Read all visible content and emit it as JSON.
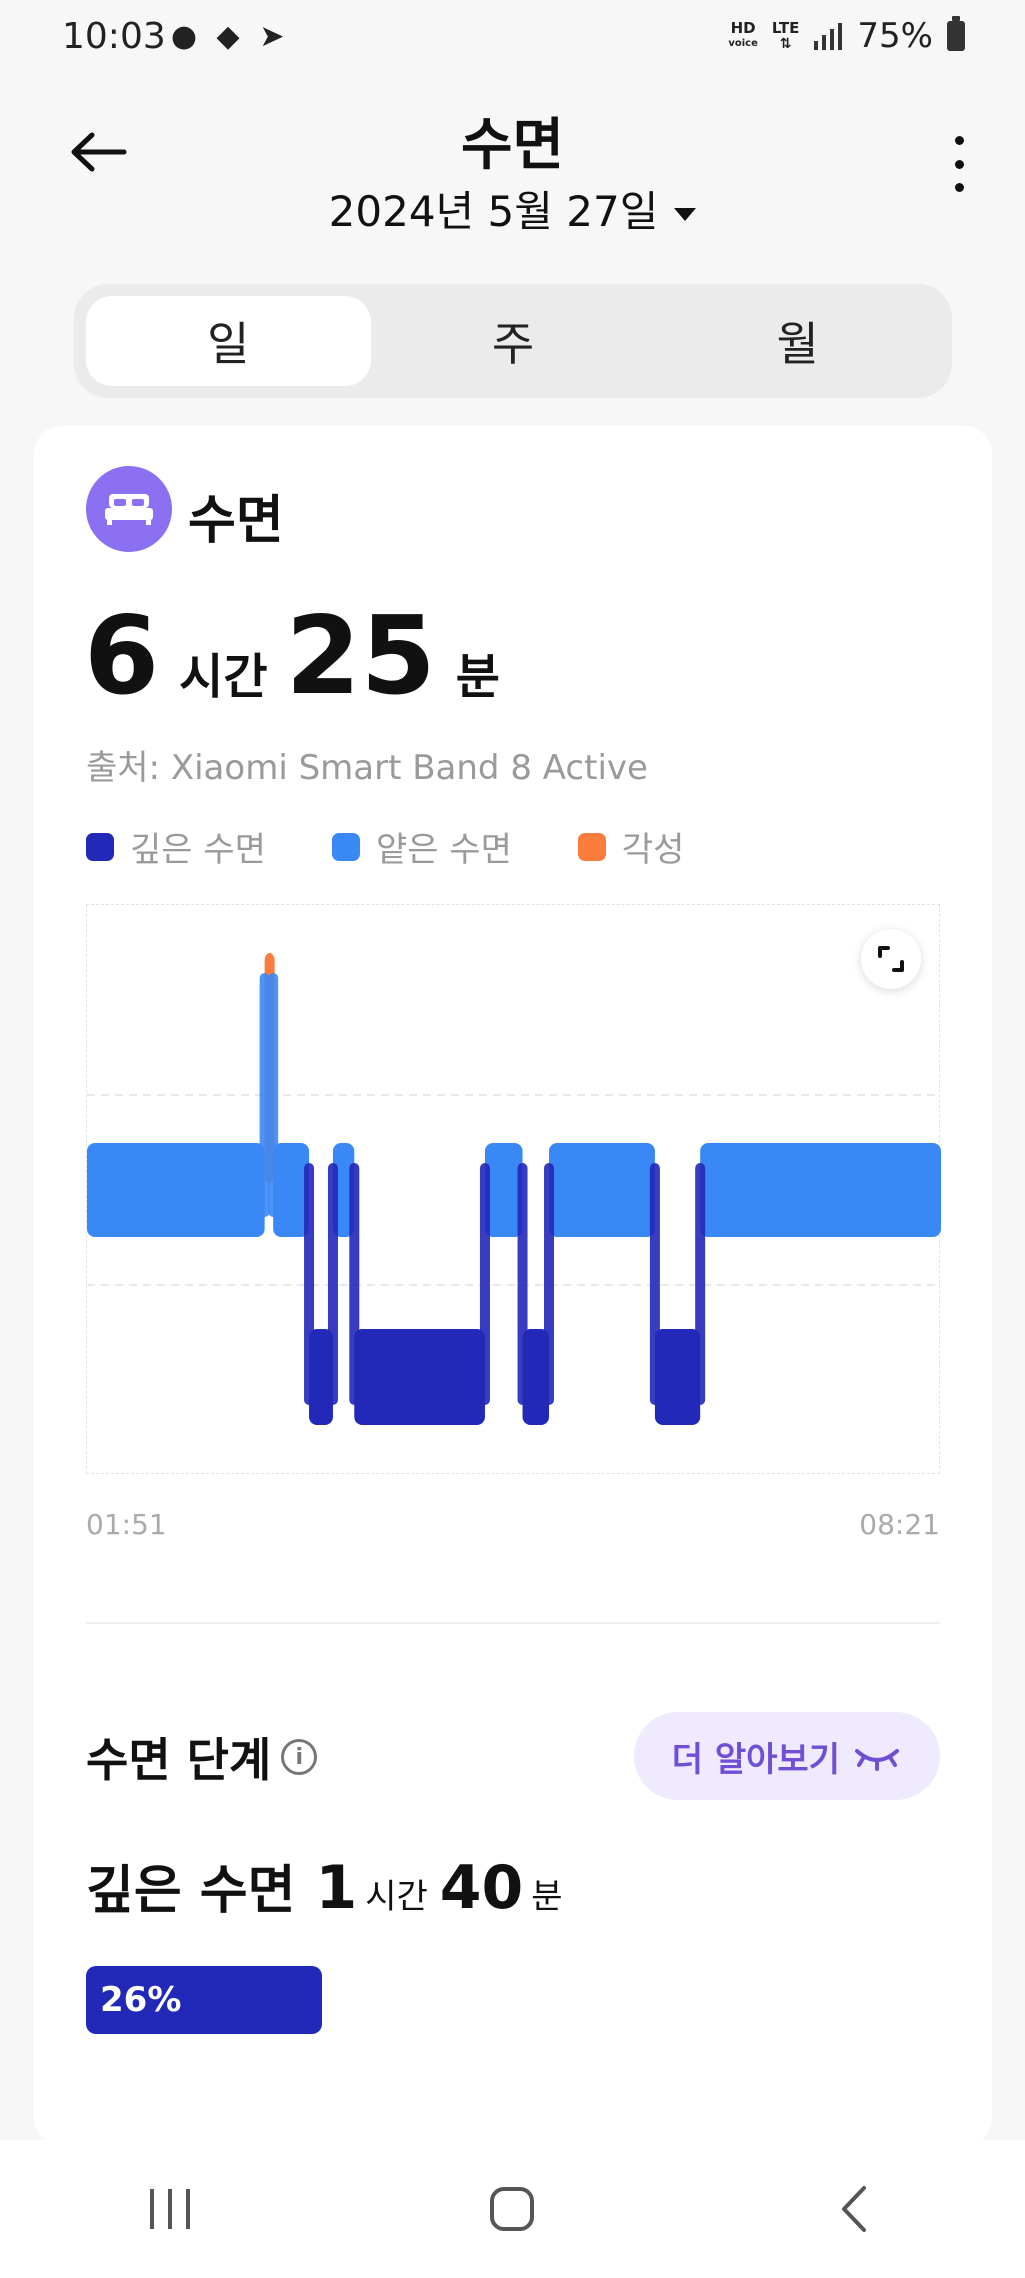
{
  "status_bar": {
    "time": "10:03",
    "hd_label": "HD",
    "voice_label": "voice",
    "lte_label": "LTE",
    "battery": "75%"
  },
  "header": {
    "title": "수면",
    "date": "2024년 5월 27일"
  },
  "tabs": [
    {
      "label": "일",
      "active": true
    },
    {
      "label": "주",
      "active": false
    },
    {
      "label": "월",
      "active": false
    }
  ],
  "card": {
    "title": "수면",
    "duration": {
      "hours": "6",
      "hours_unit": "시간",
      "minutes": "25",
      "minutes_unit": "분"
    },
    "source": "출처: Xiaomi Smart Band 8 Active",
    "legend": [
      {
        "label": "깊은 수면",
        "color": "#2228b8"
      },
      {
        "label": "얕은 수면",
        "color": "#3a88f5"
      },
      {
        "label": "각성",
        "color": "#fb7d3e"
      }
    ]
  },
  "chart_data": {
    "type": "area",
    "x_start": "01:51",
    "x_end": "08:21",
    "levels": [
      "각성",
      "얕은 수면",
      "깊은 수면"
    ],
    "segments": [
      {
        "stage": "얕은 수면",
        "start": 0.0,
        "end": 0.208
      },
      {
        "stage": "각성",
        "start": 0.208,
        "end": 0.218
      },
      {
        "stage": "얕은 수면",
        "start": 0.218,
        "end": 0.26
      },
      {
        "stage": "깊은 수면",
        "start": 0.26,
        "end": 0.288
      },
      {
        "stage": "얕은 수면",
        "start": 0.288,
        "end": 0.313
      },
      {
        "stage": "깊은 수면",
        "start": 0.313,
        "end": 0.466
      },
      {
        "stage": "얕은 수면",
        "start": 0.466,
        "end": 0.51
      },
      {
        "stage": "깊은 수면",
        "start": 0.51,
        "end": 0.541
      },
      {
        "stage": "얕은 수면",
        "start": 0.541,
        "end": 0.665
      },
      {
        "stage": "깊은 수면",
        "start": 0.665,
        "end": 0.718
      },
      {
        "stage": "얕은 수면",
        "start": 0.718,
        "end": 1.0
      }
    ]
  },
  "stages": {
    "title": "수면 단계",
    "learn_more": "더 알아보기",
    "deep": {
      "label": "깊은 수면",
      "hours": "1",
      "hours_unit": "시간",
      "minutes": "40",
      "minutes_unit": "분",
      "percent": "26%"
    }
  },
  "colors": {
    "deep": "#2228b8",
    "light": "#3a88f5",
    "awake": "#fb7d3e",
    "accent": "#8b70f2"
  },
  "icons": {
    "back": "arrow-left-icon",
    "more": "more-vert-icon",
    "bed": "bed-icon",
    "expand": "expand-icon",
    "info": "info-icon",
    "eye": "closed-eye-icon"
  }
}
